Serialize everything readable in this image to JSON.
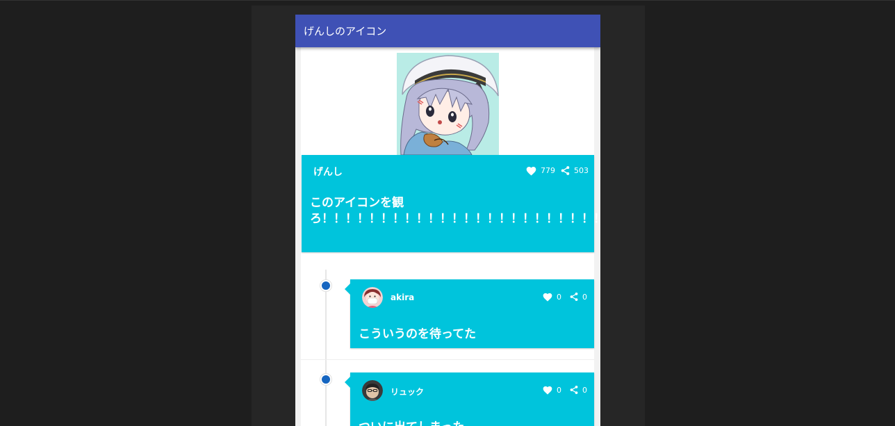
{
  "appbar": {
    "title": "げんしのアイコン"
  },
  "post": {
    "author": "げんし",
    "likes": "779",
    "shares": "503",
    "body": "このアイコンを観ろ！！！！！！！！！！！！！！！！！！！！！！！！！"
  },
  "comments": [
    {
      "author": "akira",
      "likes": "0",
      "shares": "0",
      "body": "こういうのを待ってた"
    },
    {
      "author": "リュック",
      "likes": "0",
      "shares": "0",
      "body": "ついに出てしまった、、、、"
    }
  ],
  "icons": {
    "like": "heart-icon",
    "share": "share-icon"
  },
  "colors": {
    "appbar": "#3f51b5",
    "card": "#00c4dc",
    "timeline_dot": "#1565c0",
    "background": "#1e1e1e"
  }
}
